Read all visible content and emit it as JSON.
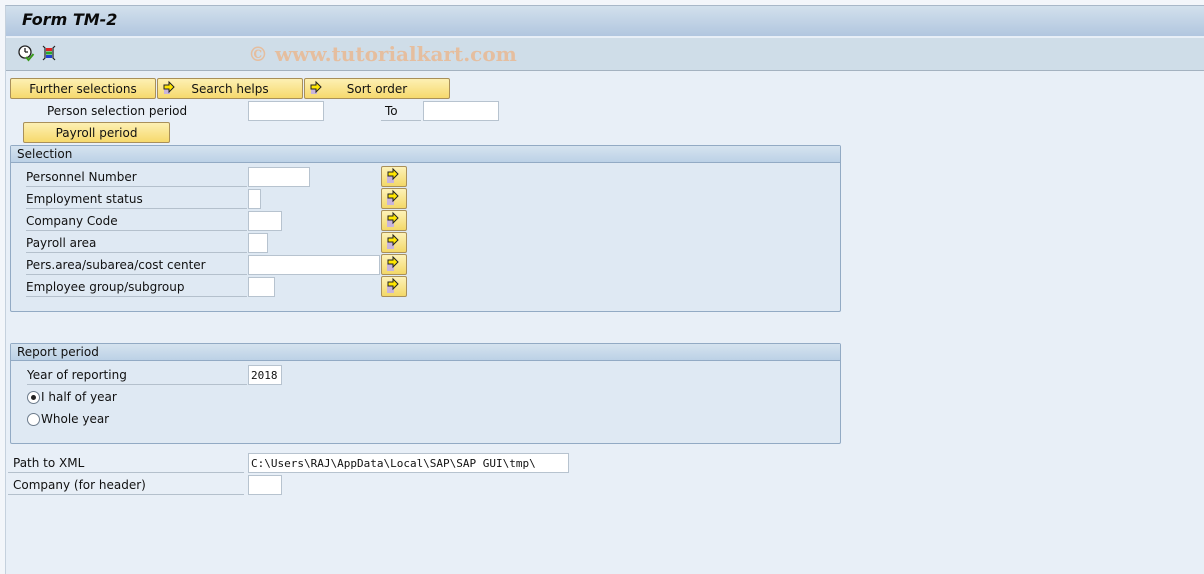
{
  "header": {
    "title": "Form TM-2"
  },
  "toolbar": {
    "icons": [
      "execute-icon",
      "get-variant-icon"
    ],
    "watermark": "© www.tutorialkart.com"
  },
  "top_buttons": {
    "further_selections": "Further selections",
    "search_helps": "Search helps",
    "sort_order": "Sort order"
  },
  "person_selection": {
    "label": "Person selection period",
    "from_value": "",
    "to_label": "To",
    "to_value": ""
  },
  "payroll_period_button": "Payroll period",
  "selection_group": {
    "title": "Selection",
    "fields": [
      {
        "label": "Personnel Number",
        "value": ""
      },
      {
        "label": "Employment status",
        "value": ""
      },
      {
        "label": "Company Code",
        "value": ""
      },
      {
        "label": "Payroll area",
        "value": ""
      },
      {
        "label": "Pers.area/subarea/cost center",
        "value": ""
      },
      {
        "label": "Employee group/subgroup",
        "value": ""
      }
    ]
  },
  "report_period_group": {
    "title": "Report period",
    "year_label": "Year of reporting",
    "year_value": "2018",
    "options": [
      {
        "label": "I half of year",
        "selected": true
      },
      {
        "label": "Whole year",
        "selected": false
      }
    ]
  },
  "output": {
    "path_label": "Path to XML",
    "path_value": "C:\\Users\\RAJ\\AppData\\Local\\SAP\\SAP GUI\\tmp\\",
    "company_label": "Company (for header)",
    "company_value": ""
  }
}
